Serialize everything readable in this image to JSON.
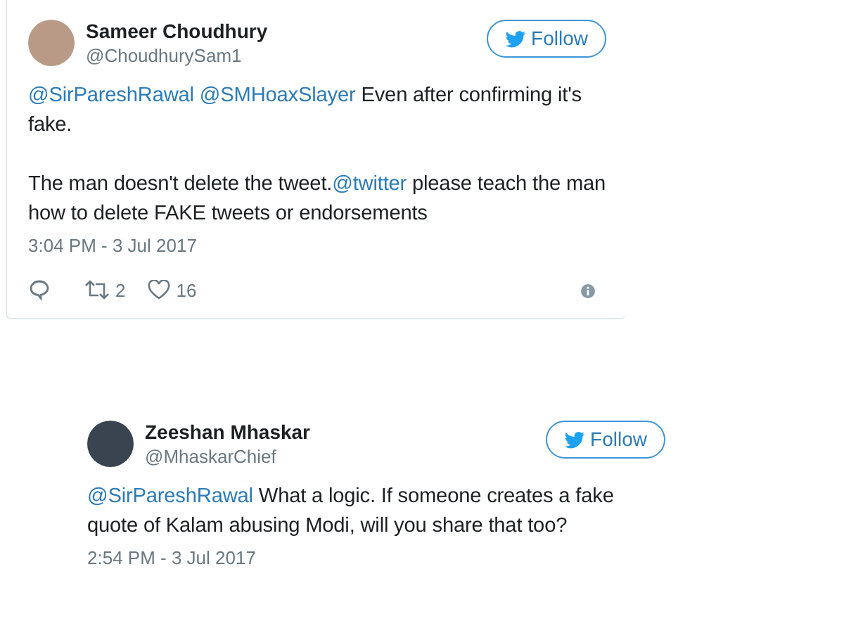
{
  "tweets": [
    {
      "name": "Sameer Choudhury",
      "handle": "@ChoudhurySam1",
      "follow": "Follow",
      "paragraphs": [
        [
          {
            "kind": "mention",
            "text": "@SirPareshRawal"
          },
          {
            "kind": "mention",
            "text": "@SMHoaxSlayer"
          },
          {
            "kind": "text",
            "text": " Even after confirming it's fake."
          }
        ],
        [
          {
            "kind": "text",
            "text": "The man doesn't delete the tweet."
          },
          {
            "kind": "mention",
            "text": "@twitter"
          },
          {
            "kind": "text",
            "text": " please teach the man how to delete FAKE tweets or endorsements"
          }
        ]
      ],
      "time": "3:04 PM - 3 Jul 2017",
      "retweets": "2",
      "likes": "16"
    },
    {
      "name": "Zeeshan Mhaskar",
      "handle": "@MhaskarChief",
      "follow": "Follow",
      "paragraphs": [
        [
          {
            "kind": "mention",
            "text": "@SirPareshRawal"
          },
          {
            "kind": "text",
            "text": " What a logic. If someone creates a fake quote of Kalam abusing Modi, will you share that too?"
          }
        ]
      ],
      "time": "2:54 PM - 3 Jul 2017"
    }
  ]
}
